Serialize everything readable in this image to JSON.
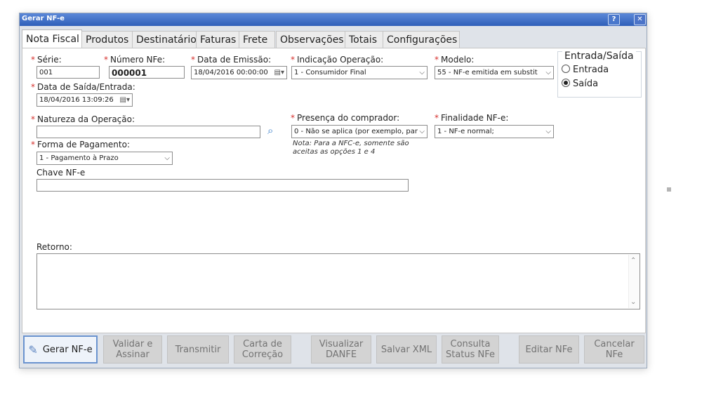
{
  "window": {
    "title": "Gerar NF-e",
    "help_label": "?",
    "close_label": "✕"
  },
  "tabs": [
    {
      "label": "Nota Fiscal",
      "active": true
    },
    {
      "label": "Produtos",
      "active": false
    },
    {
      "label": "Destinatário",
      "active": false
    },
    {
      "label": "Faturas",
      "active": false
    },
    {
      "label": "Frete",
      "active": false
    },
    {
      "label": "Observações",
      "active": false
    },
    {
      "label": "Totais",
      "active": false
    },
    {
      "label": "Configurações",
      "active": false
    }
  ],
  "form": {
    "serie": {
      "label": "Série:",
      "value": "001"
    },
    "numero": {
      "label": "Número NFe:",
      "value": "000001"
    },
    "data_emissao": {
      "label": "Data de Emissão:",
      "value": "18/04/2016 00:00:00"
    },
    "indicacao": {
      "label": "Indicação Operação:",
      "value": "1 - Consumidor Final"
    },
    "modelo": {
      "label": "Modelo:",
      "value": "55 - NF-e emitida em substit"
    },
    "entrada_saida": {
      "legend": "Entrada/Saída",
      "options": [
        {
          "label": "Entrada",
          "checked": false
        },
        {
          "label": "Saída",
          "checked": true
        }
      ]
    },
    "data_saida": {
      "label": "Data de Saída/Entrada:",
      "value": "18/04/2016 13:09:26"
    },
    "natureza": {
      "label": "Natureza da Operação:",
      "value": ""
    },
    "presenca": {
      "label": "Presença do comprador:",
      "value": "0 - Não se aplica (por exemplo, par",
      "note": "Nota: Para a NFC-e, somente são aceitas as opções 1 e 4"
    },
    "finalidade": {
      "label": "Finalidade NF-e:",
      "value": "1 - NF-e normal;"
    },
    "forma_pagamento": {
      "label": "Forma de Pagamento:",
      "value": "1 - Pagamento à Prazo"
    },
    "chave": {
      "label": "Chave NF-e",
      "value": ""
    },
    "retorno": {
      "label": "Retorno:",
      "value": ""
    }
  },
  "buttons": {
    "gerar": "Gerar NF-e",
    "validar": "Validar e Assinar",
    "transmitir": "Transmitir",
    "carta": "Carta de Correção",
    "visualizar": "Visualizar DANFE",
    "salvar": "Salvar XML",
    "consulta": "Consulta Status NFe",
    "editar": "Editar NFe",
    "cancelar": "Cancelar NFe"
  },
  "icons": {
    "help": "help-icon",
    "close": "close-icon",
    "search": "search-icon",
    "calendar": "calendar-icon",
    "chevron": "chevron-down-icon",
    "gerar": "invoice-icon"
  },
  "colors": {
    "required": "#d6312e",
    "titlebar": "#2f5fb9",
    "primary_button_border": "#6a93cf"
  }
}
